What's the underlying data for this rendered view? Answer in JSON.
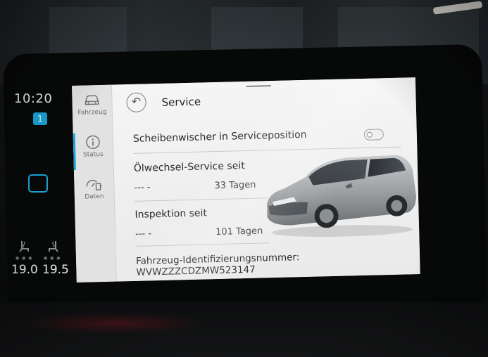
{
  "status_bar": {
    "time": "10:20",
    "profile_badge": "1",
    "temp_left": "19.0",
    "temp_right": "19.5"
  },
  "sidebar": {
    "items": [
      {
        "label": "Fahrzeug",
        "icon": "car-icon",
        "active": false
      },
      {
        "label": "Status",
        "icon": "info-icon",
        "active": true
      },
      {
        "label": "Daten",
        "icon": "fuel-gauge-icon",
        "active": false
      }
    ]
  },
  "header": {
    "title": "Service"
  },
  "rows": {
    "wiper_label": "Scheibenwischer in Serviceposition",
    "oil_label": "Ölwechsel-Service seit",
    "oil_distance": "--- -",
    "oil_days": "33 Tagen",
    "inspection_label": "Inspektion seit",
    "inspection_distance": "--- -",
    "inspection_days": "101 Tagen",
    "vin_label": "Fahrzeug-Identifizierungsnummer: WVWZZZCDZMW523147"
  },
  "colors": {
    "accent": "#1aa6d8",
    "screen_bg": "#ececec",
    "text": "#222222"
  }
}
